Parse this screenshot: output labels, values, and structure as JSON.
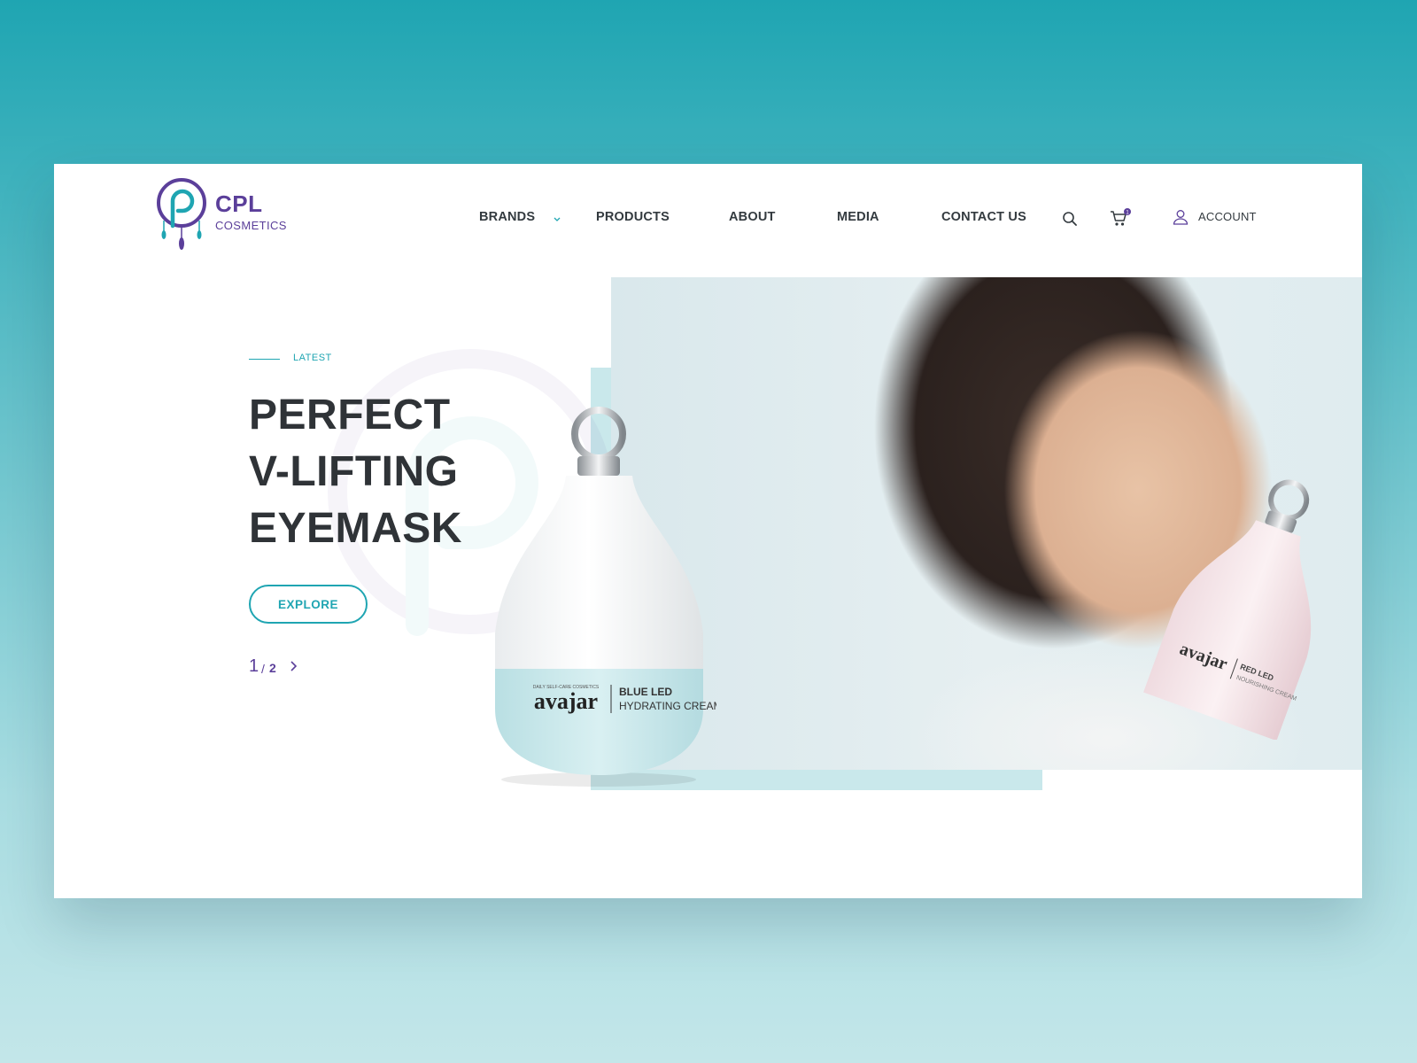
{
  "brand": {
    "name": "CPL",
    "subname": "COSMETICS",
    "colors": {
      "primary": "#1fa5b2",
      "secondary": "#5b3f9a",
      "text": "#2f3337"
    }
  },
  "nav": {
    "items": [
      "BRANDS",
      "PRODUCTS",
      "ABOUT",
      "MEDIA",
      "CONTACT US"
    ],
    "account_label": "ACCOUNT",
    "cart_count": "1",
    "icons": [
      "chevron-down-icon",
      "search-icon",
      "cart-icon",
      "user-icon"
    ]
  },
  "hero": {
    "eyebrow": "LATEST",
    "title_lines": [
      "PERFECT",
      "V-LIFTING",
      "EYEMASK"
    ],
    "cta_label": "EXPLORE",
    "pager": {
      "current": "1",
      "separator": "/",
      "total": "2"
    },
    "product_large": {
      "brand": "avajar",
      "tagline": "DAILY SELF-CARE COSMETICS",
      "line1": "BLUE LED",
      "line2": "HYDRATING CREAM"
    },
    "product_small": {
      "brand": "avajar",
      "line1": "RED LED",
      "line2": "NOURISHING CREAM"
    }
  }
}
